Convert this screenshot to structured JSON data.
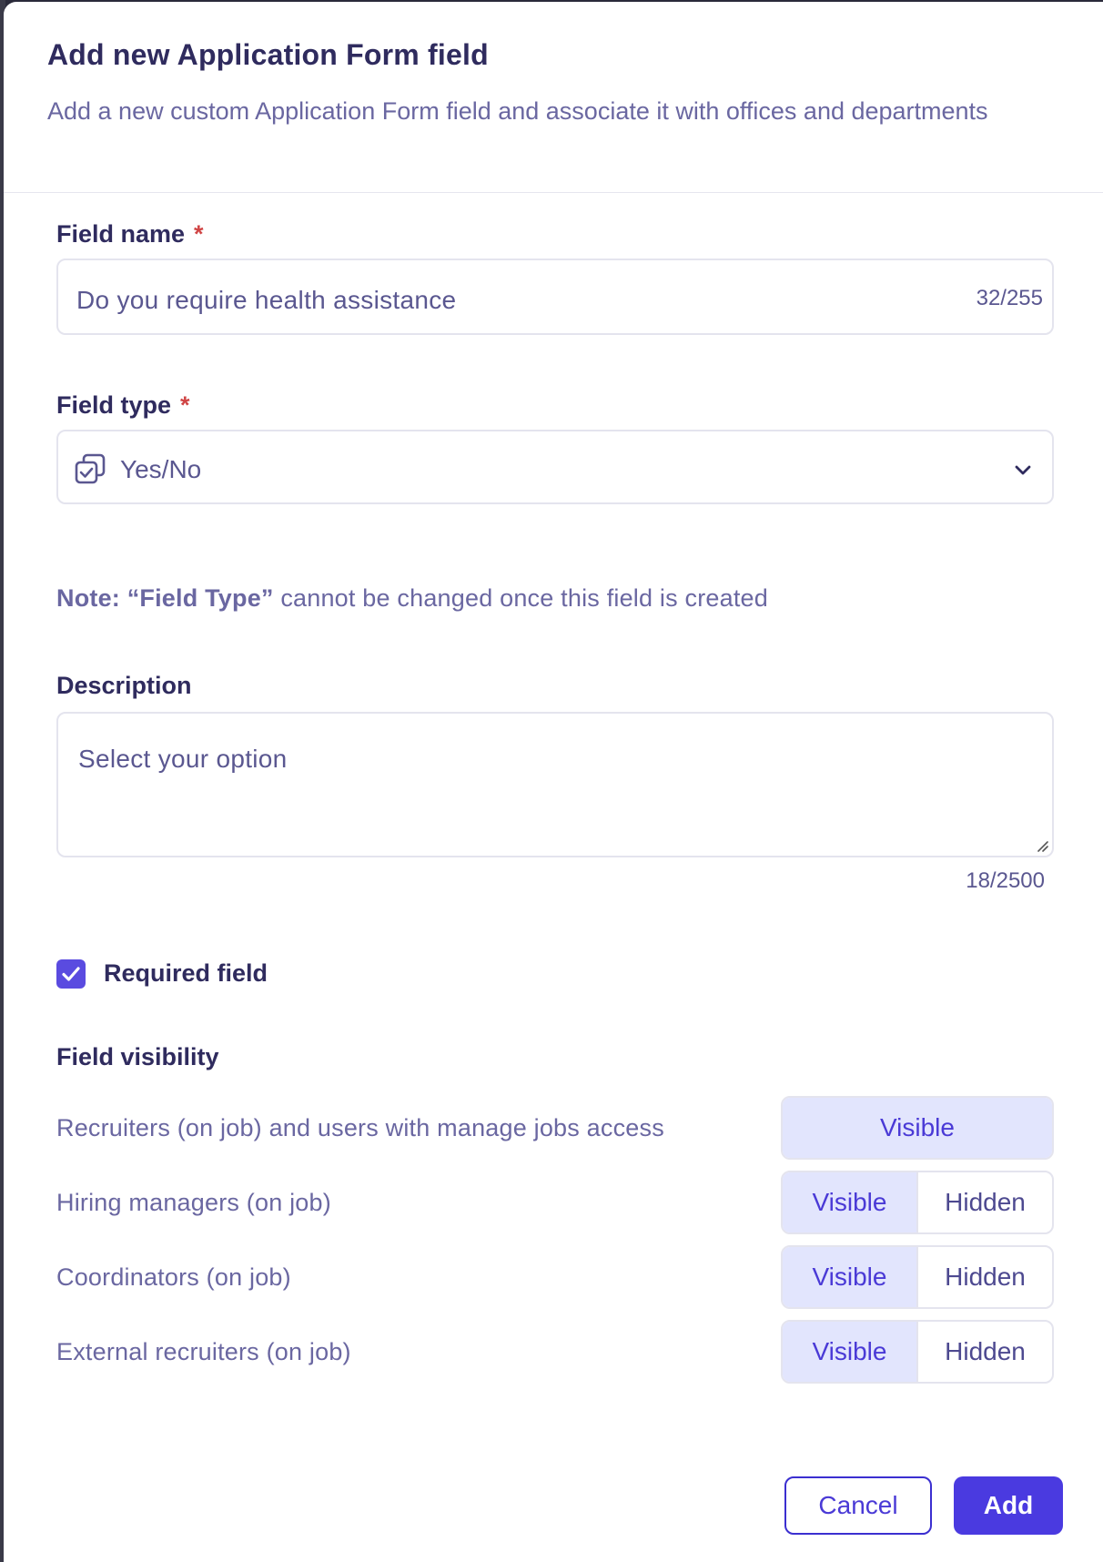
{
  "header": {
    "title": "Add new Application Form field",
    "subtitle": "Add a new custom Application Form field and associate it with offices and departments"
  },
  "field_name": {
    "label": "Field name",
    "required_mark": "*",
    "value": "Do you require health assistance",
    "counter": "32/255"
  },
  "field_type": {
    "label": "Field type",
    "required_mark": "*",
    "value": "Yes/No",
    "icon": "yes-no-checkbox-icon"
  },
  "note": {
    "prefix": "Note: “Field Type”",
    "text": " cannot be changed once this field is created"
  },
  "description": {
    "label": "Description",
    "value": "Select your option",
    "counter": "18/2500"
  },
  "required_field": {
    "label": "Required field",
    "checked": true
  },
  "visibility": {
    "title": "Field visibility",
    "rows": [
      {
        "label": "Recruiters (on job) and users with manage jobs access",
        "options": [
          "Visible"
        ],
        "selected": "Visible"
      },
      {
        "label": "Hiring managers (on job)",
        "options": [
          "Visible",
          "Hidden"
        ],
        "selected": "Visible"
      },
      {
        "label": "Coordinators (on job)",
        "options": [
          "Visible",
          "Hidden"
        ],
        "selected": "Visible"
      },
      {
        "label": "External recruiters (on job)",
        "options": [
          "Visible",
          "Hidden"
        ],
        "selected": "Visible"
      }
    ]
  },
  "actions": {
    "cancel": "Cancel",
    "add": "Add"
  },
  "colors": {
    "accent": "#4a3ae0",
    "selected_segment": "#e2e5fd",
    "required": "#d04545"
  }
}
